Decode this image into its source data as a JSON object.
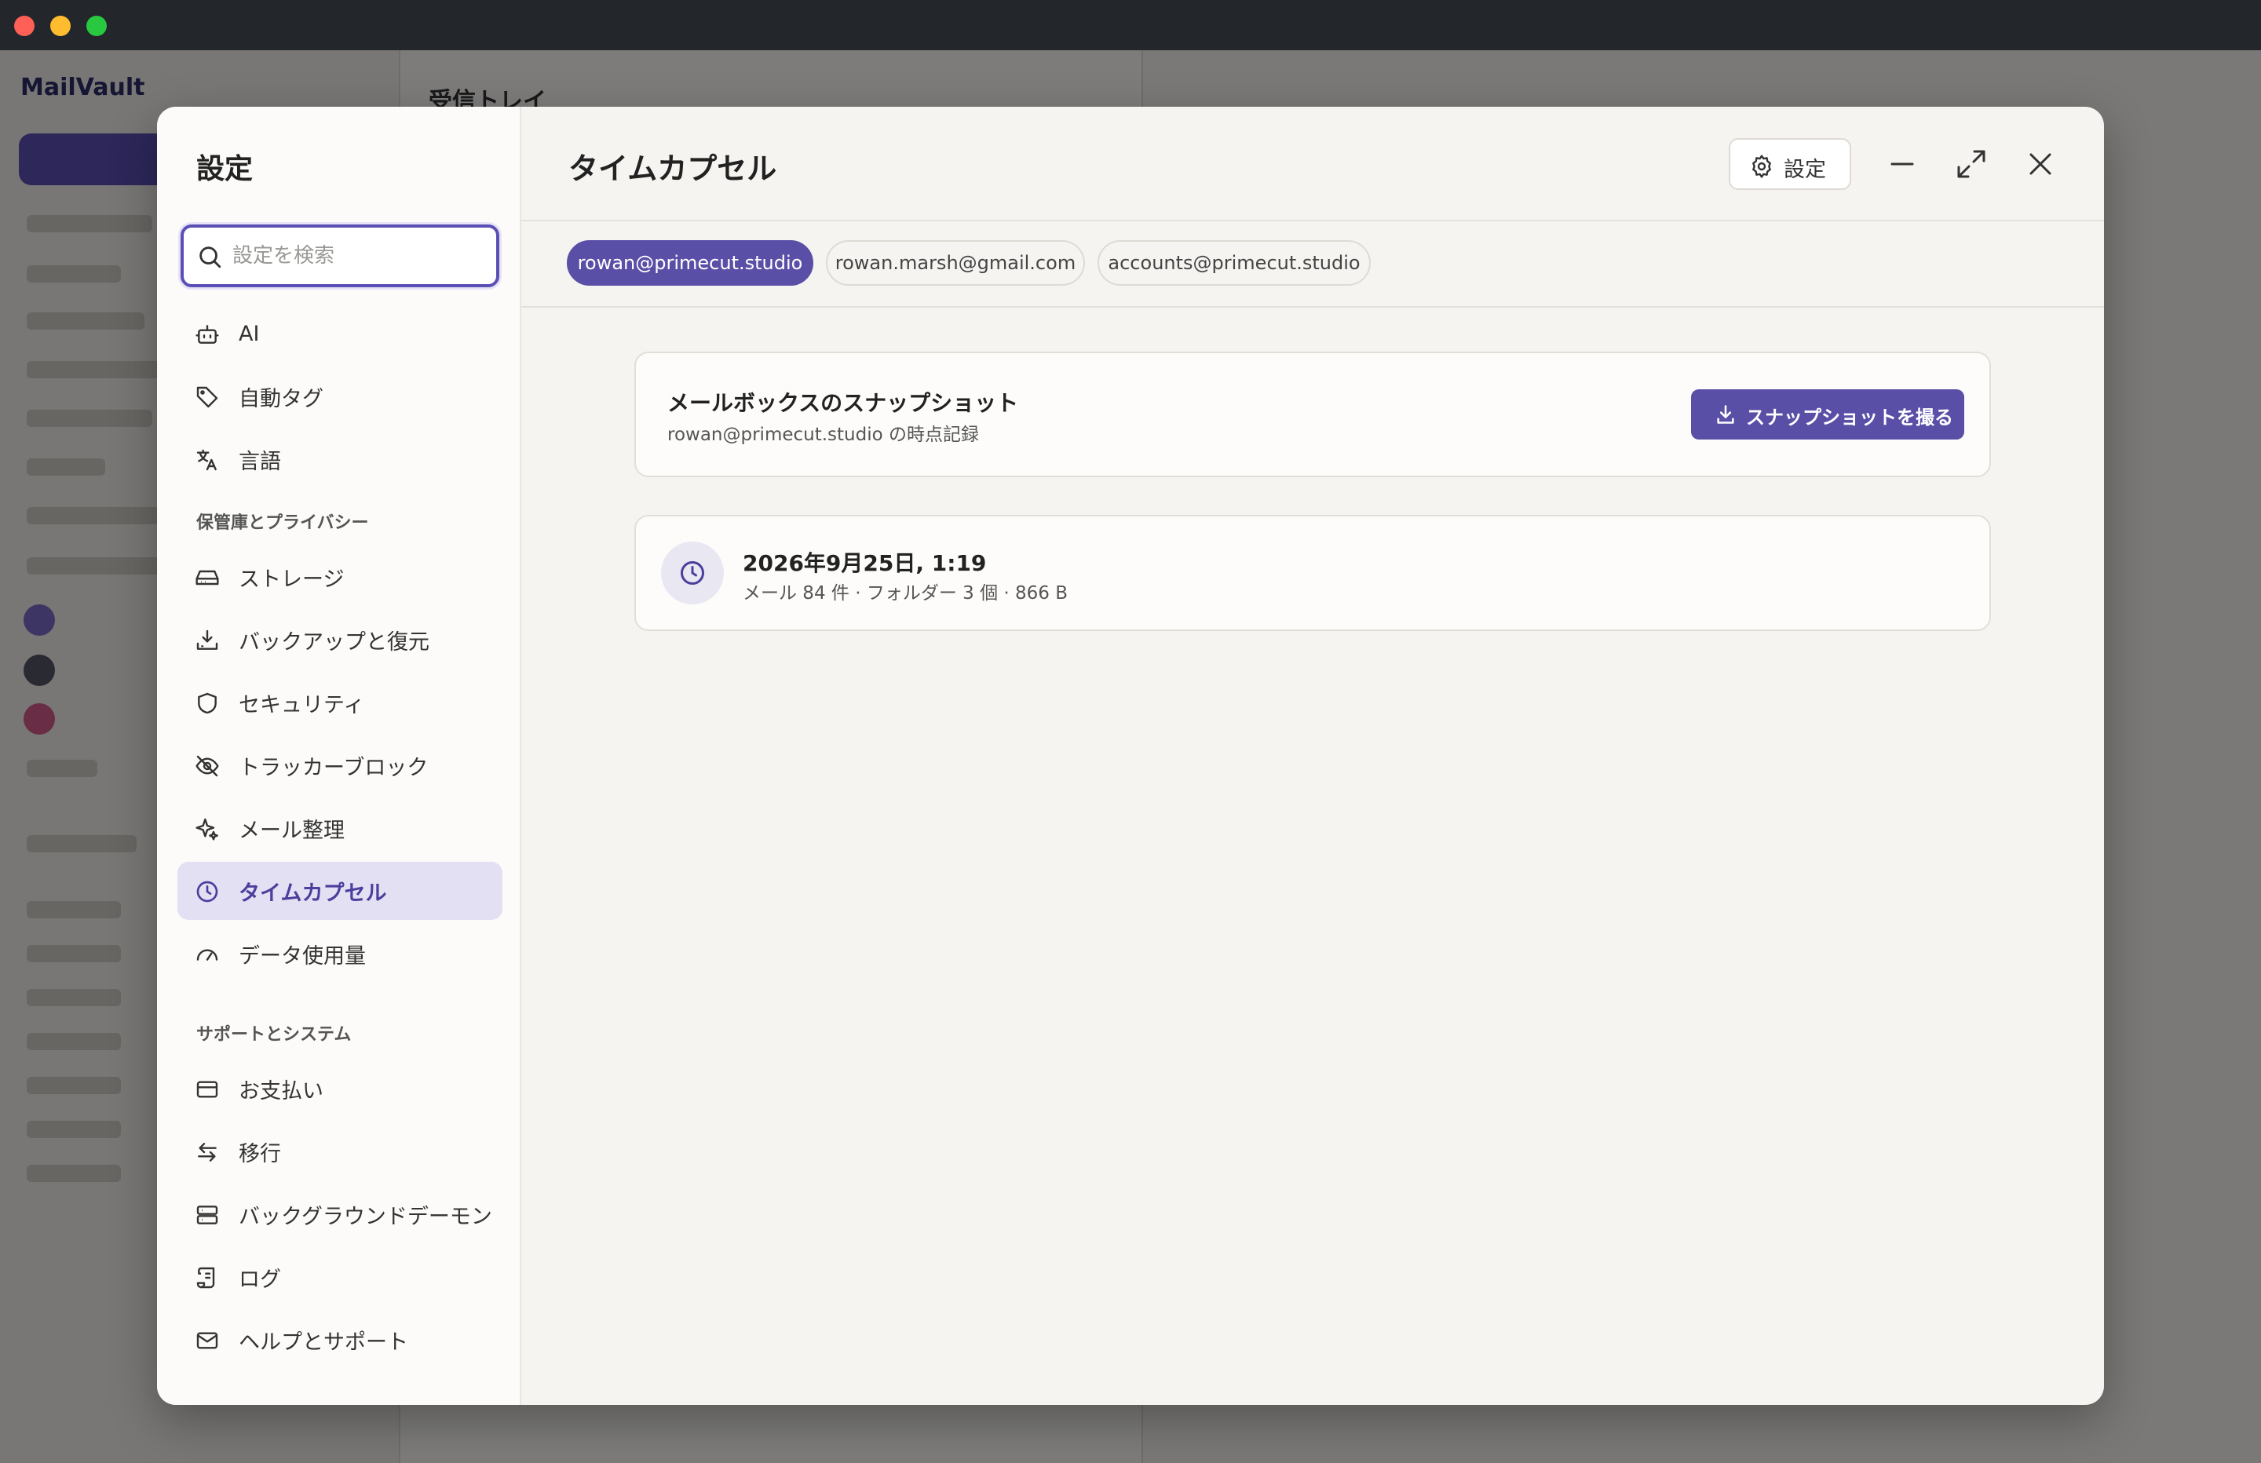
{
  "background_app": {
    "logo": "MailVault",
    "mid_title": "受信トレイ"
  },
  "settings": {
    "title": "設定",
    "search_placeholder": "設定を検索",
    "nav_top": [
      {
        "label": "AI",
        "icon": "robot-icon"
      },
      {
        "label": "自動タグ",
        "icon": "tag-icon"
      },
      {
        "label": "言語",
        "icon": "translate-icon"
      }
    ],
    "section_vault": "保管庫とプライバシー",
    "nav_vault": [
      {
        "label": "ストレージ",
        "icon": "drive-icon"
      },
      {
        "label": "バックアップと復元",
        "icon": "download-tray-icon"
      },
      {
        "label": "セキュリティ",
        "icon": "shield-icon"
      },
      {
        "label": "トラッカーブロック",
        "icon": "eye-off-icon"
      },
      {
        "label": "メール整理",
        "icon": "sparkles-icon"
      },
      {
        "label": "タイムカプセル",
        "icon": "clock-icon",
        "active": true
      },
      {
        "label": "データ使用量",
        "icon": "gauge-icon"
      }
    ],
    "section_support": "サポートとシステム",
    "nav_support": [
      {
        "label": "お支払い",
        "icon": "credit-card-icon"
      },
      {
        "label": "移行",
        "icon": "arrows-swap-icon"
      },
      {
        "label": "バックグラウンドデーモン",
        "icon": "server-icon"
      },
      {
        "label": "ログ",
        "icon": "scroll-icon"
      },
      {
        "label": "ヘルプとサポート",
        "icon": "mail-icon"
      }
    ]
  },
  "main": {
    "title": "タイムカプセル",
    "settings_button": "設定",
    "accounts": [
      {
        "label": "rowan@primecut.studio",
        "active": true
      },
      {
        "label": "rowan.marsh@gmail.com",
        "active": false
      },
      {
        "label": "accounts@primecut.studio",
        "active": false
      }
    ],
    "snapshot_card": {
      "title": "メールボックスのスナップショット",
      "subtitle": "rowan@primecut.studio の時点記録",
      "button": "スナップショットを撮る"
    },
    "snapshots": [
      {
        "date": "2026年9月25日, 1:19",
        "meta": "メール 84 件 · フォルダー 3 個 · 866 B"
      }
    ]
  },
  "colors": {
    "accent": "#5a4fa6",
    "active_nav_bg": "#e4e0f3"
  }
}
